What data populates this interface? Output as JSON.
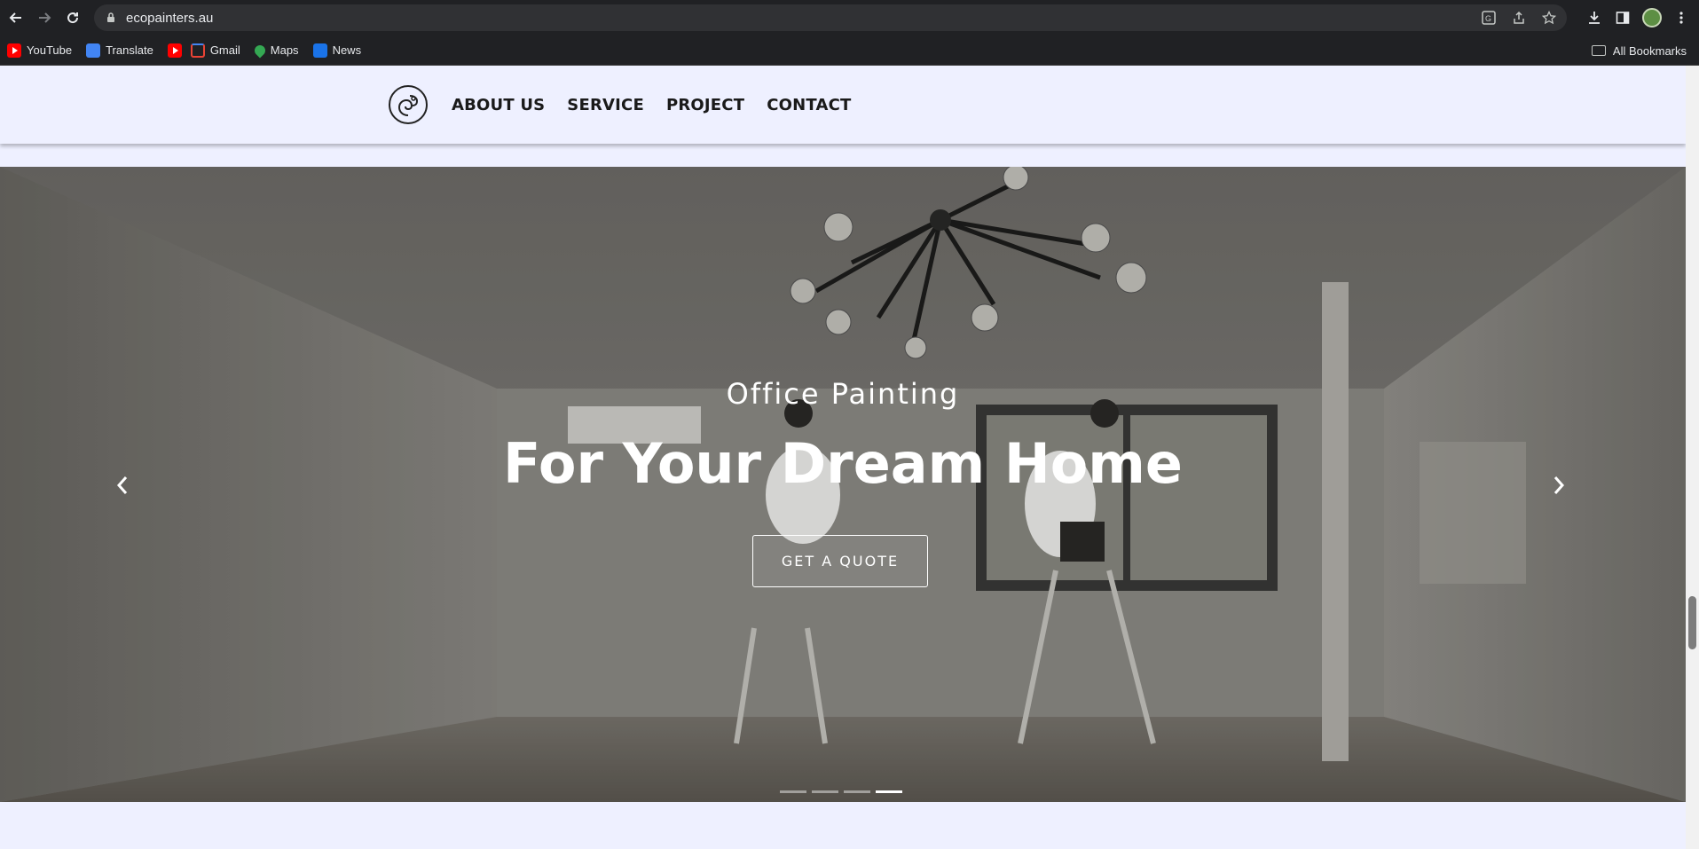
{
  "browser": {
    "url": "ecopainters.au",
    "bookmarks": [
      {
        "label": "YouTube",
        "icon": "youtube-icon"
      },
      {
        "label": "Translate",
        "icon": "translate-icon"
      },
      {
        "label": "",
        "icon": "youtube-icon"
      },
      {
        "label": "Gmail",
        "icon": "gmail-icon"
      },
      {
        "label": "Maps",
        "icon": "maps-icon"
      },
      {
        "label": "News",
        "icon": "news-icon"
      }
    ],
    "all_bookmarks_label": "All Bookmarks"
  },
  "site": {
    "nav": [
      "ABOUT US",
      "SERVICE",
      "PROJECT",
      "CONTACT"
    ],
    "hero": {
      "subtitle": "Office Painting",
      "title": "For Your Dream Home",
      "cta_label": "GET A QUOTE",
      "slide_count": 4,
      "active_slide": 4
    }
  },
  "colors": {
    "page_background": "#eef0ff",
    "chrome_background": "#202124",
    "hero_text": "#ffffff"
  }
}
